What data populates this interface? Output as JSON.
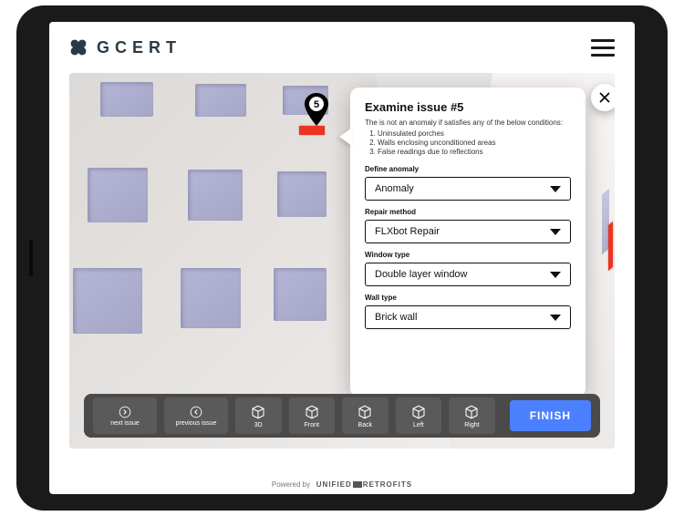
{
  "brand": {
    "name": "GCERT"
  },
  "issue": {
    "pin_number": "5",
    "title": "Examine issue #5",
    "intro": "The is not an anomaly if satisfies any of the below conditions:",
    "conditions": [
      "Uninsulated porches",
      "Walls enclosing unconditioned areas",
      "False readings due to reflections"
    ],
    "fields": [
      {
        "label": "Define anomaly",
        "value": "Anomaly"
      },
      {
        "label": "Repair method",
        "value": "FLXbot Repair"
      },
      {
        "label": "Window type",
        "value": "Double layer window"
      },
      {
        "label": "Wall type",
        "value": "Brick wall"
      }
    ]
  },
  "toolbar": {
    "next": "next issue",
    "prev": "previous issue",
    "views": [
      "3D",
      "Front",
      "Back",
      "Left",
      "Right"
    ],
    "finish": "FINISH"
  },
  "footer": {
    "prefix": "Powered by",
    "company": "UNIFIED",
    "company2": "RETROFITS"
  }
}
